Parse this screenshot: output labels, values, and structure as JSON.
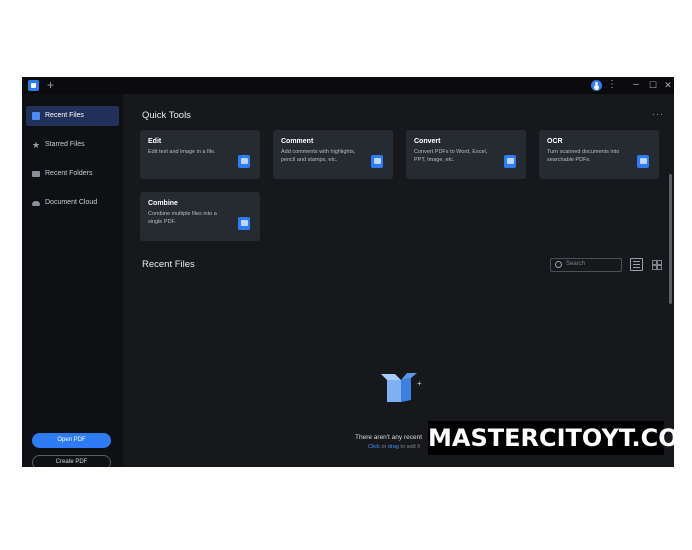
{
  "titlebar": {
    "new_tab_label": "+",
    "icons": [
      "app-logo-icon",
      "account-icon",
      "kebab-menu-icon",
      "minimize-icon",
      "maximize-icon",
      "close-icon"
    ],
    "menu_glyph": "⋮",
    "minimize_glyph": "–",
    "maximize_glyph": "☐",
    "close_glyph": "✕"
  },
  "sidebar": {
    "items": [
      {
        "label": "Recent Files",
        "icon": "document-icon",
        "active": true
      },
      {
        "label": "Starred Files",
        "icon": "star-icon",
        "active": false
      },
      {
        "label": "Recent Folders",
        "icon": "folder-icon",
        "active": false
      },
      {
        "label": "Document Cloud",
        "icon": "cloud-icon",
        "active": false
      }
    ],
    "open_pdf_label": "Open PDF",
    "create_pdf_label": "Create PDF"
  },
  "quick_tools": {
    "title": "Quick Tools",
    "more_label": "···",
    "cards": [
      {
        "title": "Edit",
        "desc": "Edit text and image in a file.",
        "icon": "edit-icon"
      },
      {
        "title": "Comment",
        "desc": "Add comments with highlights, pencil and stamps, etc.",
        "icon": "comment-icon"
      },
      {
        "title": "Convert",
        "desc": "Convert PDFs to Word, Excel, PPT, Image, etc.",
        "icon": "convert-icon"
      },
      {
        "title": "OCR",
        "desc": "Turn scanned documents into searchable PDFs.",
        "icon": "ocr-icon"
      },
      {
        "title": "Combine",
        "desc": "Combine multiple files into a single PDF.",
        "icon": "combine-icon"
      }
    ]
  },
  "recent_files": {
    "title": "Recent Files",
    "search_placeholder": "Search",
    "empty_text": "There aren't any recent",
    "empty_link_click": "Click",
    "empty_link_or": " or ",
    "empty_link_drag": "drag",
    "empty_link_rest": " to add fi"
  },
  "watermark": "MASTERCITOYT.COM",
  "colors": {
    "accent": "#2f7bf5",
    "sidebar_bg": "#0f1013",
    "main_bg": "#17181c",
    "card_bg": "#262b31"
  }
}
